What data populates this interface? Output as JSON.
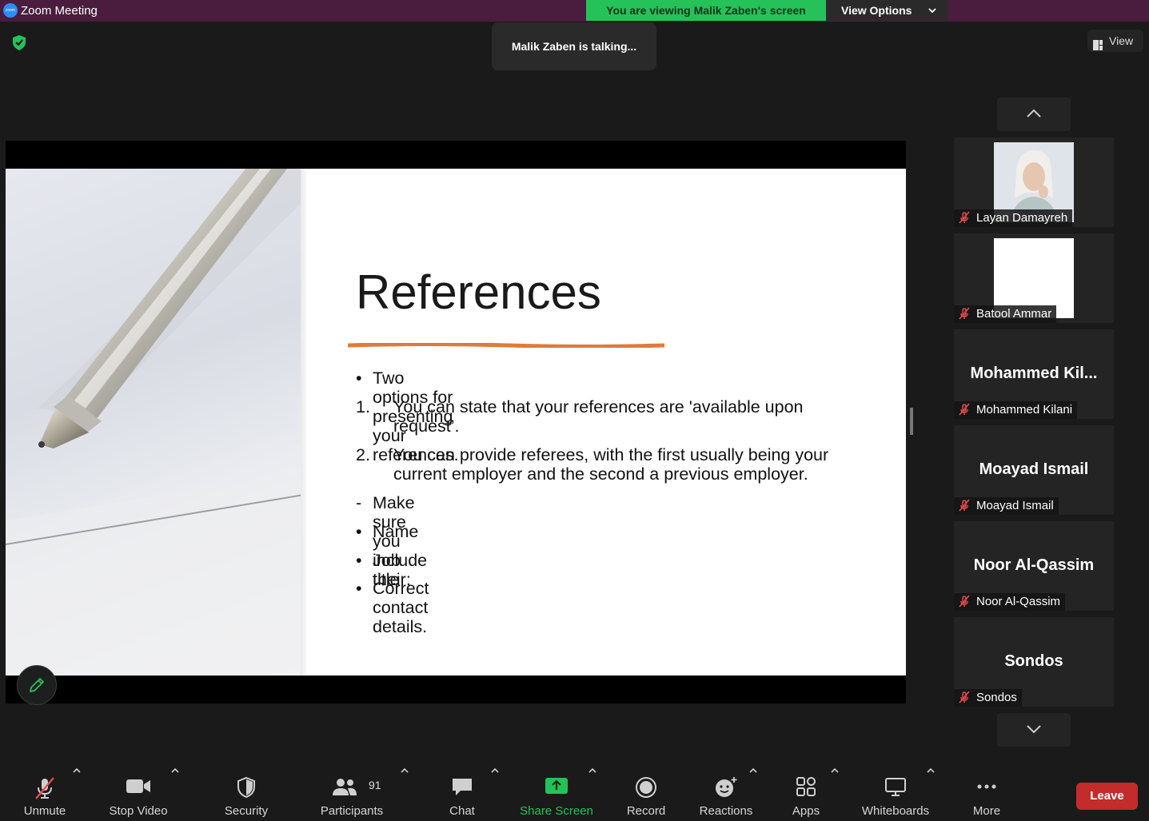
{
  "window": {
    "app_title": "Zoom Meeting",
    "viewing_banner": "You are viewing Malik Zaben's screen",
    "view_options_label": "View Options"
  },
  "meeting": {
    "talking_indicator": "Malik Zaben is talking...",
    "view_button_label": "View"
  },
  "slide": {
    "title": "References",
    "accent_color": "#e07b3a",
    "bullets": [
      {
        "marker": "•",
        "text": "Two options for presenting your references."
      },
      {
        "marker": "1.",
        "text": "You can state that your references are 'available upon request’."
      },
      {
        "marker": "2.",
        "text": "You can provide referees, with the first usually being your current employer and the second a previous employer."
      },
      {
        "marker": "-",
        "text": "Make sure you include their:"
      },
      {
        "marker": "•",
        "text": "Name"
      },
      {
        "marker": "•",
        "text": "Job title"
      },
      {
        "marker": "•",
        "text": "Correct contact details."
      }
    ]
  },
  "participants_gallery": [
    {
      "display": "photo",
      "name": "Layan Damayreh",
      "muted": true
    },
    {
      "display": "blank",
      "name": "Batool Ammar",
      "muted": true
    },
    {
      "display": "text",
      "big_name": "Mohammed  Kil...",
      "name": "Mohammed Kilani",
      "muted": true
    },
    {
      "display": "text",
      "big_name": "Moayad Ismail",
      "name": "Moayad Ismail",
      "muted": true
    },
    {
      "display": "text",
      "big_name": "Noor Al-Qassim",
      "name": "Noor Al-Qassim",
      "muted": true
    },
    {
      "display": "text",
      "big_name": "Sondos",
      "name": "Sondos",
      "muted": true
    }
  ],
  "toolbar": {
    "unmute": "Unmute",
    "stop_video": "Stop Video",
    "security": "Security",
    "participants": "Participants",
    "participants_count": "91",
    "chat": "Chat",
    "share_screen": "Share Screen",
    "record": "Record",
    "reactions": "Reactions",
    "apps": "Apps",
    "whiteboards": "Whiteboards",
    "more": "More",
    "leave": "Leave"
  },
  "colors": {
    "title_bar": "#4a1c3d",
    "banner_green": "#25c25a",
    "leave_red": "#c42b2b",
    "muted_red": "#e84c4c"
  }
}
